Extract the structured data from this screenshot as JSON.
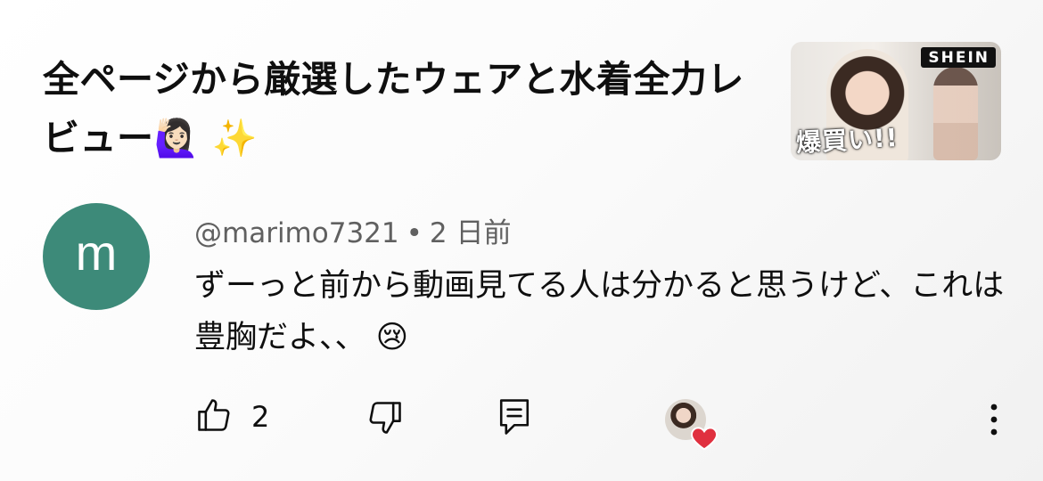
{
  "video": {
    "title": "全ページから厳選したウェアと水着全力レビュー",
    "title_emojis": "🙋🏻‍♀️ ✨",
    "thumbnail": {
      "brand": "SHEIN",
      "overlay_text": "爆買い!!"
    }
  },
  "comment": {
    "avatar_letter": "m",
    "avatar_color": "#3d8a79",
    "author": "@marimo7321",
    "separator": "•",
    "time": "2 日前",
    "text": "ずーっと前から動画見てる人は分かると思うけど、これは豊胸だよ、、 😢",
    "like_count": "2"
  },
  "actions": {
    "like_icon": "thumbs-up-icon",
    "dislike_icon": "thumbs-down-icon",
    "reply_icon": "reply-icon",
    "creator_heart_icon": "heart-icon",
    "more_icon": "more-vertical-icon"
  },
  "colors": {
    "text_primary": "#0f0f0f",
    "text_secondary": "#606060",
    "heart": "#e0303f"
  }
}
